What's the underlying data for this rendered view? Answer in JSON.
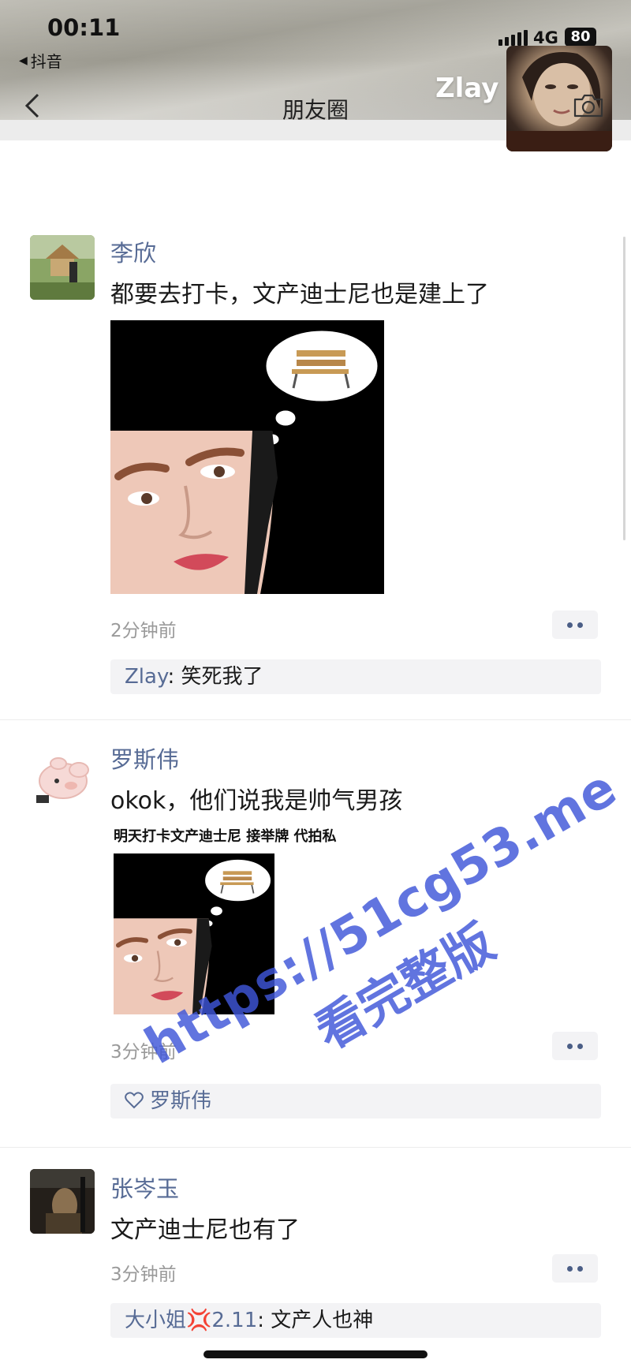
{
  "status": {
    "time": "00:11",
    "back_app": "抖音",
    "network": "4G",
    "battery": "80"
  },
  "nav": {
    "title": "朋友圈",
    "user_name": "Zlay"
  },
  "posts": [
    {
      "name": "李欣",
      "text": "都要去打卡，文产迪士尼也是建上了",
      "time": "2分钟前",
      "comment": {
        "author": "Zlay",
        "separator": ": ",
        "text": "笑死我了"
      }
    },
    {
      "name": "罗斯伟",
      "text": "okok，他们说我是帅气男孩",
      "image_caption": "明天打卡文产迪士尼 接举牌 代拍私",
      "time": "3分钟前",
      "likes": "罗斯伟"
    },
    {
      "name": "张岑玉",
      "text": "文产迪士尼也有了",
      "time": "3分钟前",
      "comment": {
        "author": "大小姐💢2.11",
        "separator": ": ",
        "text": "文产人也神"
      }
    }
  ],
  "watermark": {
    "url": "https://51cg53.me",
    "subtitle": "看完整版"
  },
  "colors": {
    "link_name": "#576b95",
    "comment_bg": "#f3f3f5",
    "watermark": "#3f56d8"
  }
}
